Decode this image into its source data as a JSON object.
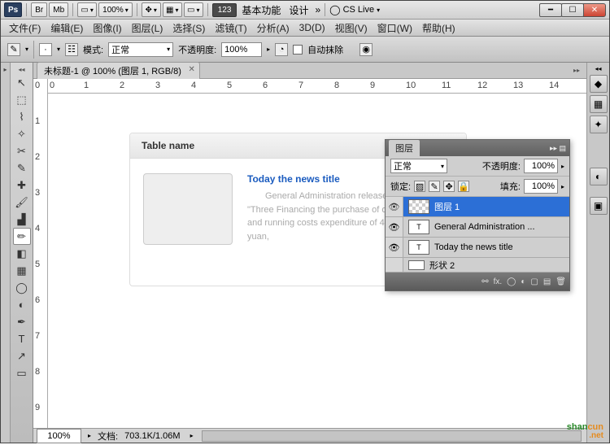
{
  "topbar": {
    "ps": "Ps",
    "br": "Br",
    "mb": "Mb",
    "zoom": "100%",
    "label123": "123",
    "basic_func": "基本功能",
    "design": "设计",
    "more": "»",
    "cslive": "CS Live"
  },
  "menu": [
    "文件(F)",
    "编辑(E)",
    "图像(I)",
    "图层(L)",
    "选择(S)",
    "滤镜(T)",
    "分析(A)",
    "3D(D)",
    "视图(V)",
    "窗口(W)",
    "帮助(H)"
  ],
  "optbar": {
    "mode_label": "模式:",
    "mode_value": "正常",
    "opacity_label": "不透明度:",
    "opacity_value": "100%",
    "autoerase": "自动抹除"
  },
  "doc": {
    "tab_title": "未标题-1 @ 100% (图层 1, RGB/8)",
    "card_title": "Table name",
    "news_title": "Today the news title",
    "news_body": "General Administration released the 2011 \"Three Financing the purchase of official vehicles and running costs expenditure of 445,373,600 yuan,"
  },
  "ruler_h": [
    "0",
    "1",
    "2",
    "3",
    "4",
    "5",
    "6",
    "7",
    "8",
    "9",
    "10",
    "11",
    "12",
    "13",
    "14"
  ],
  "ruler_v": [
    "0",
    "1",
    "2",
    "3",
    "4",
    "5",
    "6",
    "7",
    "8",
    "9"
  ],
  "statusbar": {
    "zoom": "100%",
    "doc_label": "文档:",
    "doc_value": "703.1K/1.06M"
  },
  "layerspanel": {
    "tab": "图层",
    "blend": "正常",
    "opacity_label": "不透明度:",
    "opacity_value": "100%",
    "lock_label": "锁定:",
    "fill_label": "填充:",
    "fill_value": "100%",
    "layers": [
      {
        "name": "图层 1",
        "type": "bitmap",
        "sel": true
      },
      {
        "name": "General Administration ...",
        "type": "text",
        "sel": false
      },
      {
        "name": "Today the news title",
        "type": "text",
        "sel": false
      },
      {
        "name": "形状 2",
        "type": "shape",
        "sel": false
      }
    ]
  },
  "watermark": {
    "t1": "shan",
    "t2": "cun",
    "net": ".net"
  }
}
